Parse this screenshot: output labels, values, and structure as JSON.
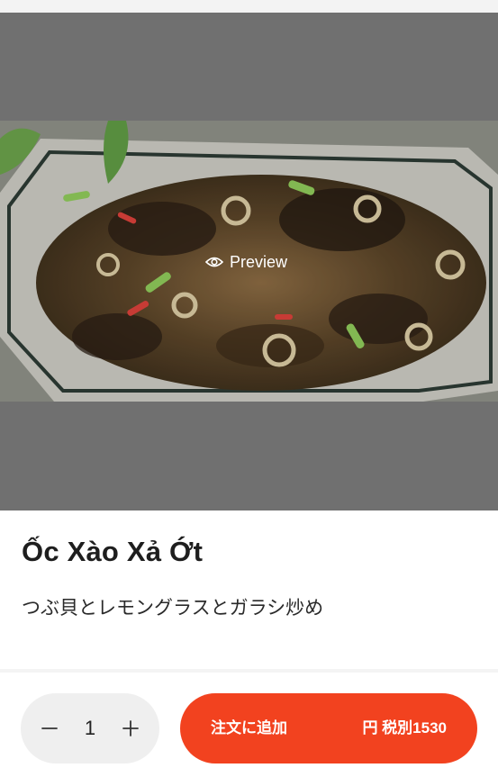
{
  "item": {
    "name": "Ốc Xào Xả Ớt",
    "description": "つぶ貝とレモングラスとガラシ炒め",
    "image": {
      "overlay_label": "Preview",
      "icon": "eye-icon"
    }
  },
  "order": {
    "quantity": "1",
    "decrement_icon": "minus-icon",
    "increment_icon": "plus-icon",
    "add_label": "注文に追加",
    "price_label": "円 税別1530"
  },
  "colors": {
    "accent": "#f2421f",
    "image_backdrop": "#7a7a7a",
    "stepper_bg": "#efefef",
    "title_text": "#1e1e1e"
  }
}
